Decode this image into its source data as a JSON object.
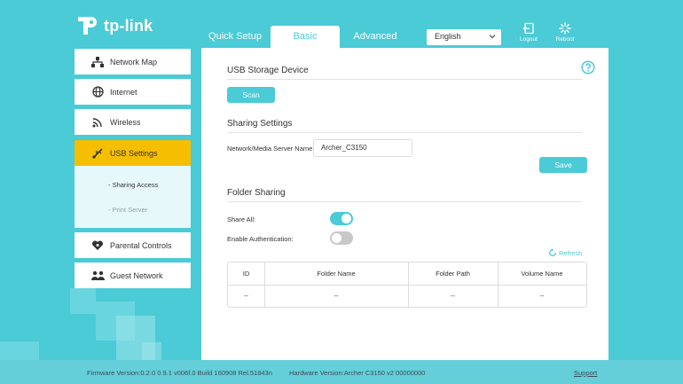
{
  "brand": {
    "logo_text": "tp-link"
  },
  "colors": {
    "accent": "#4acbd6",
    "active_menu": "#f5bf00",
    "background": "#4acbd6"
  },
  "header": {
    "tabs": [
      {
        "label": "Quick Setup",
        "active": false
      },
      {
        "label": "Basic",
        "active": true
      },
      {
        "label": "Advanced",
        "active": false
      }
    ],
    "language": {
      "selected": "English"
    },
    "logout_label": "Logout",
    "reboot_label": "Reboot"
  },
  "sidebar": {
    "items": [
      {
        "label": "Network Map",
        "icon": "network-map-icon"
      },
      {
        "label": "Internet",
        "icon": "globe-icon"
      },
      {
        "label": "Wireless",
        "icon": "wifi-icon"
      },
      {
        "label": "USB Settings",
        "icon": "usb-icon",
        "active": true
      },
      {
        "label": "Parental Controls",
        "icon": "heart-icon"
      },
      {
        "label": "Guest Network",
        "icon": "guest-users-icon"
      }
    ],
    "sub_items": [
      {
        "label": "- Sharing Access",
        "active": true
      },
      {
        "label": "- Print Server",
        "active": false
      }
    ]
  },
  "main": {
    "usb_storage": {
      "title": "USB Storage Device",
      "scan_label": "Scan"
    },
    "sharing_settings": {
      "title": "Sharing Settings",
      "server_name_label": "Network/Media Server Name:",
      "server_name_value": "Archer_C3150",
      "save_label": "Save"
    },
    "folder_sharing": {
      "title": "Folder Sharing",
      "share_all_label": "Share All:",
      "share_all_on": true,
      "enable_auth_label": "Enable Authentication:",
      "enable_auth_on": false,
      "refresh_label": "Refresh",
      "table": {
        "headers": [
          "ID",
          "Folder Name",
          "Folder Path",
          "Volume Name"
        ],
        "rows": [
          [
            "--",
            "--",
            "--",
            "--"
          ]
        ]
      }
    }
  },
  "footer": {
    "firmware": "Firmware Version:0.2.0 0.9.1 v006f.0 Build 160908 Rel.51843n",
    "hardware": "Hardware Version:Archer C3150 v2 00000000",
    "support": "Support"
  }
}
